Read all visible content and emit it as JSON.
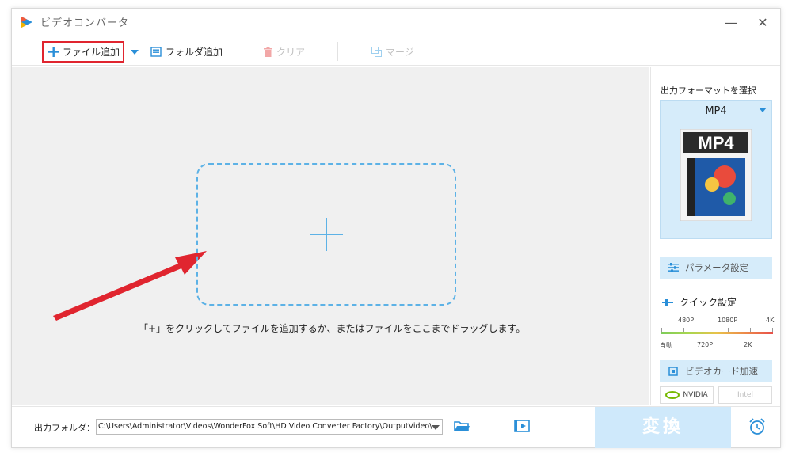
{
  "window": {
    "title": "ビデオコンバータ"
  },
  "toolbar": {
    "add_file": "ファイル追加",
    "add_folder": "フォルダ追加",
    "clear": "クリア",
    "merge": "マージ"
  },
  "main": {
    "hint": "「+」をクリックしてファイルを追加するか、またはファイルをここまでドラッグします。"
  },
  "right_panel": {
    "format_title": "出力フォーマットを選択",
    "format_name": "MP4",
    "format_image_text": "MP4",
    "param_button": "パラメータ設定",
    "quick_title": "クイック設定",
    "quality_top": [
      "480P",
      "1080P",
      "4K"
    ],
    "quality_bottom": [
      "自動",
      "720P",
      "2K"
    ],
    "gpu_button": "ビデオカード加速",
    "vendors": [
      "NVIDIA",
      "Intel"
    ]
  },
  "bottom": {
    "output_label": "出力フォルダ：",
    "output_path": "C:\\Users\\Administrator\\Videos\\WonderFox Soft\\HD Video Converter Factory\\OutputVideo\\",
    "convert_button": "変換"
  },
  "colors": {
    "accent": "#2a8fd8",
    "highlight_box": "#e0252f",
    "panel_bg": "#d6ecfa",
    "arrow": "#e0252f"
  }
}
